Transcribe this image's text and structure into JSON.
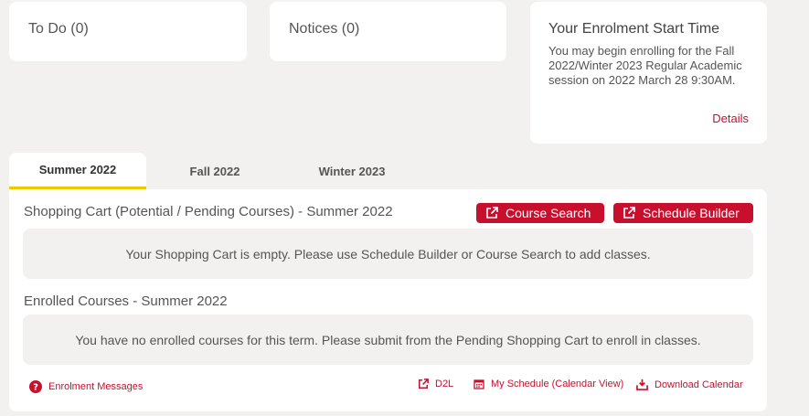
{
  "cards": {
    "todo": {
      "title": "To Do (0)"
    },
    "notices": {
      "title": "Notices (0)"
    },
    "enrolment": {
      "title": "Your Enrolment Start Time",
      "text": "You may begin enrolling for the Fall 2022/Winter 2023 Regular Academic session on 2022 March 28 9:30AM.",
      "details_label": "Details"
    }
  },
  "tabs": [
    {
      "label": "Summer 2022",
      "active": true
    },
    {
      "label": "Fall 2022",
      "active": false
    },
    {
      "label": "Winter 2023",
      "active": false
    }
  ],
  "shopping_cart": {
    "heading": "Shopping Cart (Potential / Pending Courses) - Summer 2022",
    "course_search_label": "Course Search",
    "schedule_builder_label": "Schedule Builder",
    "empty_message": "Your Shopping Cart is empty. Please use Schedule Builder or Course Search to add classes."
  },
  "enrolled": {
    "heading": "Enrolled Courses - Summer 2022",
    "empty_message": "You have no enrolled courses for this term. Please submit from the Pending Shopping Cart to enroll in classes."
  },
  "footer": {
    "enrolment_messages": "Enrolment Messages",
    "d2l": "D2L",
    "my_schedule": "My Schedule (Calendar View)",
    "download_calendar": "Download Calendar"
  },
  "colors": {
    "accent": "#c8102e",
    "tab_underline": "#f0c800",
    "background": "#f2f1f0"
  }
}
